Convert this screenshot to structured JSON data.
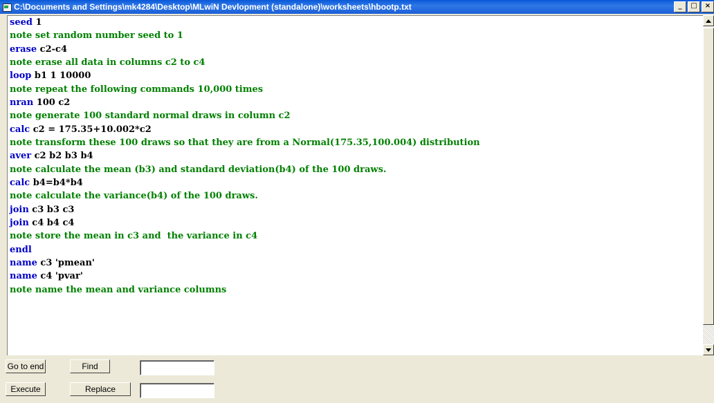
{
  "window": {
    "title": "C:\\Documents and Settings\\mk4284\\Desktop\\MLwiN Devlopment (standalone)\\worksheets\\hbootp.txt",
    "minimize_glyph": "_",
    "maximize_glyph": "□",
    "close_glyph": "×"
  },
  "script_lines": [
    {
      "kw": "seed",
      "arg": " 1",
      "note": ""
    },
    {
      "kw": "",
      "arg": "",
      "note": "note set random number seed to 1"
    },
    {
      "kw": "erase",
      "arg": " c2-c4",
      "note": ""
    },
    {
      "kw": "",
      "arg": "",
      "note": "note erase all data in columns c2 to c4"
    },
    {
      "kw": "loop",
      "arg": " b1 1 10000",
      "note": ""
    },
    {
      "kw": "",
      "arg": "",
      "note": "note repeat the following commands 10,000 times"
    },
    {
      "kw": "nran",
      "arg": " 100 c2",
      "note": ""
    },
    {
      "kw": "",
      "arg": "",
      "note": "note generate 100 standard normal draws in column c2"
    },
    {
      "kw": "calc",
      "arg": " c2 = 175.35+10.002*c2",
      "note": ""
    },
    {
      "kw": "",
      "arg": "",
      "note": "note transform these 100 draws so that they are from a Normal(175.35,100.004) distribution"
    },
    {
      "kw": "aver",
      "arg": " c2 b2 b3 b4",
      "note": ""
    },
    {
      "kw": "",
      "arg": "",
      "note": "note calculate the mean (b3) and standard deviation(b4) of the 100 draws."
    },
    {
      "kw": "calc",
      "arg": " b4=b4*b4",
      "note": ""
    },
    {
      "kw": "",
      "arg": "",
      "note": "note calculate the variance(b4) of the 100 draws."
    },
    {
      "kw": "join",
      "arg": " c3 b3 c3",
      "note": ""
    },
    {
      "kw": "join",
      "arg": " c4 b4 c4",
      "note": ""
    },
    {
      "kw": "",
      "arg": "",
      "note": "note store the mean in c3 and  the variance in c4"
    },
    {
      "kw": "endl",
      "arg": "",
      "note": ""
    },
    {
      "kw": "name",
      "arg": " c3 'pmean'",
      "note": ""
    },
    {
      "kw": "name",
      "arg": " c4 'pvar'",
      "note": ""
    },
    {
      "kw": "",
      "arg": "",
      "note": "note name the mean and variance columns"
    }
  ],
  "toolbar": {
    "go_to_end_label": "Go to end",
    "find_label": "Find",
    "find_value": "",
    "execute_label": "Execute",
    "replace_label": "Replace",
    "replace_value": ""
  }
}
